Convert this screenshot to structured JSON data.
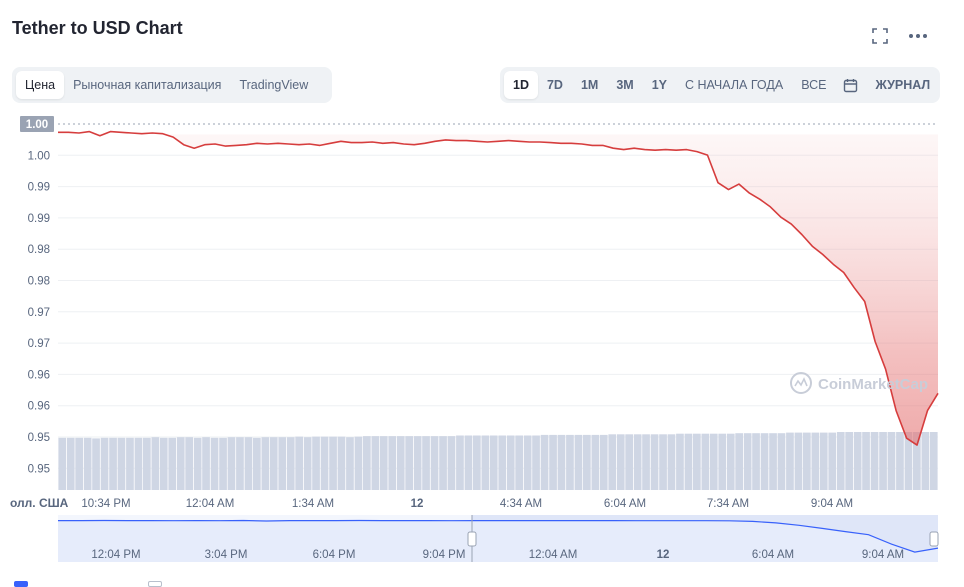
{
  "header": {
    "title": "Tether to USD Chart"
  },
  "icons": {
    "fullscreen": "fullscreen-icon",
    "more": "more-horizontal-icon",
    "calendar": "calendar-icon"
  },
  "tabs_left": [
    {
      "label": "Цена",
      "active": true
    },
    {
      "label": "Рыночная капитализация",
      "active": false
    },
    {
      "label": "TradingView",
      "active": false
    }
  ],
  "tabs_right": [
    {
      "label": "1D",
      "active": true
    },
    {
      "label": "7D",
      "active": false
    },
    {
      "label": "1M",
      "active": false
    },
    {
      "label": "3M",
      "active": false
    },
    {
      "label": "1Y",
      "active": false
    },
    {
      "label": "С НАЧАЛА ГОДА",
      "active": false
    },
    {
      "label": "ВСЕ",
      "active": false
    }
  ],
  "journal_label": "ЖУРНАЛ",
  "watermark": "CoinMarketCap",
  "colors": {
    "line": "#d63d3d",
    "volume": "#cfd6e4",
    "navigator_line": "#3861fb",
    "navigator_fill": "#e6ecfb"
  },
  "chart_data": {
    "type": "line",
    "title": "Tether to USD Chart",
    "ylabel": "",
    "y_axis_unit_label": "олл. США",
    "y_ticks": [
      "1.00",
      "1.00",
      "0.99",
      "0.99",
      "0.98",
      "0.98",
      "0.97",
      "0.97",
      "0.96",
      "0.96",
      "0.95",
      "0.95"
    ],
    "x_ticks": [
      "10:34 PM",
      "12:04 AM",
      "1:34 AM",
      "12",
      "4:34 AM",
      "6:04 AM",
      "7:34 AM",
      "9:04 AM"
    ],
    "navigator_ticks": [
      "12:04 PM",
      "3:04 PM",
      "6:04 PM",
      "9:04 PM",
      "12:04 AM",
      "12",
      "6:04 AM",
      "9:04 AM"
    ],
    "ylim": [
      0.9485,
      1.0015
    ],
    "current_value_label": "1.00",
    "grid": true,
    "series": [
      {
        "values": [
          1.0003,
          1.0003,
          1.0002,
          1.0004,
          0.9998,
          1.0004,
          1.0003,
          1.0002,
          1.0001,
          1.0002,
          1.0001,
          0.9996,
          0.9985,
          0.998,
          0.9985,
          0.9986,
          0.9983,
          0.9984,
          0.9985,
          0.9987,
          0.9986,
          0.9987,
          0.9986,
          0.9985,
          0.9986,
          0.9984,
          0.9987,
          0.999,
          0.9988,
          0.9988,
          0.9989,
          0.9987,
          0.9988,
          0.9986,
          0.9985,
          0.9987,
          0.999,
          0.9992,
          0.9991,
          0.9991,
          0.999,
          0.9989,
          0.999,
          0.9991,
          0.999,
          0.9989,
          0.9989,
          0.9988,
          0.9987,
          0.9987,
          0.9986,
          0.9984,
          0.9984,
          0.998,
          0.9978,
          0.998,
          0.9978,
          0.9977,
          0.9978,
          0.9977,
          0.9978,
          0.9975,
          0.997,
          0.993,
          0.992,
          0.9928,
          0.9915,
          0.9906,
          0.9895,
          0.988,
          0.987,
          0.9855,
          0.9838,
          0.9826,
          0.9812,
          0.98,
          0.9778,
          0.9758,
          0.97,
          0.966,
          0.96,
          0.956,
          0.955,
          0.96,
          0.9625
        ]
      }
    ],
    "volume": [
      0.9,
      0.9,
      0.9,
      0.9,
      0.89,
      0.9,
      0.9,
      0.9,
      0.9,
      0.9,
      0.9,
      0.91,
      0.9,
      0.9,
      0.91,
      0.91,
      0.9,
      0.91,
      0.9,
      0.9,
      0.91,
      0.91,
      0.91,
      0.9,
      0.91,
      0.91,
      0.91,
      0.91,
      0.92,
      0.91,
      0.92,
      0.92,
      0.92,
      0.92,
      0.91,
      0.92,
      0.93,
      0.93,
      0.93,
      0.93,
      0.93,
      0.93,
      0.93,
      0.93,
      0.93,
      0.93,
      0.93,
      0.94,
      0.94,
      0.94,
      0.94,
      0.94,
      0.94,
      0.94,
      0.94,
      0.94,
      0.94,
      0.95,
      0.95,
      0.95,
      0.95,
      0.95,
      0.95,
      0.95,
      0.95,
      0.96,
      0.96,
      0.96,
      0.96,
      0.96,
      0.96,
      0.96,
      0.96,
      0.97,
      0.97,
      0.97,
      0.97,
      0.97,
      0.97,
      0.97,
      0.98,
      0.98,
      0.98,
      0.98,
      0.98,
      0.98,
      0.99,
      0.99,
      0.99,
      0.99,
      0.99,
      0.99,
      1.0,
      1.0,
      1.0,
      1.0,
      1.0,
      1.0,
      1.0,
      1.0,
      1.0,
      1.0,
      1.0,
      1.0
    ],
    "navigator_values": [
      1.0,
      1.0,
      1.0001,
      1.0,
      1.0,
      0.9999,
      1.0,
      0.9998,
      1.0001,
      0.9995,
      1.0,
      1.0,
      1.0,
      1.0001,
      1.0,
      1.0,
      1.0,
      0.9999,
      1.0,
      1.0,
      1.0,
      1.0,
      1.0,
      1.0,
      1.0,
      0.9999,
      0.9999,
      0.9998,
      0.9998,
      0.9997,
      0.999,
      0.997,
      0.994,
      0.99,
      0.986,
      0.982,
      0.97,
      0.96,
      0.965
    ]
  }
}
